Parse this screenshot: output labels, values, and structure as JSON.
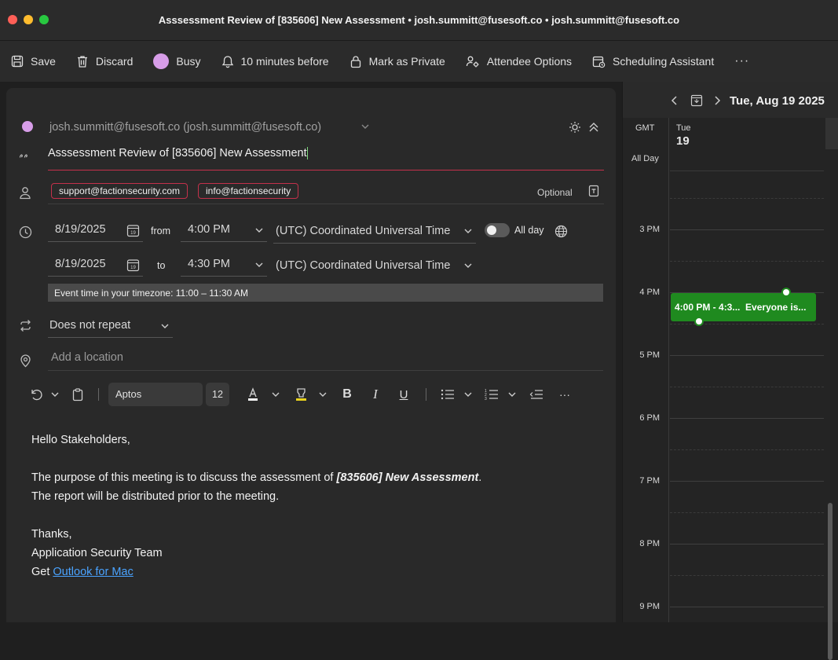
{
  "window": {
    "title": "Asssessment Review of [835606] New Assessment • josh.summitt@fusesoft.co • josh.summitt@fusesoft.co"
  },
  "toolbar": {
    "save": "Save",
    "discard": "Discard",
    "busy": "Busy",
    "reminder": "10 minutes before",
    "private": "Mark as Private",
    "attendee_options": "Attendee Options",
    "scheduling": "Scheduling Assistant",
    "more": "···"
  },
  "colors": {
    "busy": "#d79de8",
    "event": "#1f8a1f",
    "accent_border": "#c4314b",
    "link": "#4aa3ff"
  },
  "compose": {
    "sender": "josh.summitt@fusesoft.co (josh.summitt@fusesoft.co)",
    "subject": "Asssessment Review of [835606] New Assessment",
    "attendees": [
      "support@factionsecurity.com",
      "info@factionsecurity"
    ],
    "optional_label": "Optional",
    "start_date": "8/19/2025",
    "from_label": "from",
    "start_time": "4:00 PM",
    "start_tz": "(UTC) Coordinated Universal Time",
    "allday_label": "All day",
    "allday_on": false,
    "end_date": "8/19/2025",
    "to_label": "to",
    "end_time": "4:30 PM",
    "end_tz": "(UTC) Coordinated Universal Time",
    "local_time_banner": "Event time in your timezone: 11:00 – 11:30 AM",
    "repeat": "Does not repeat",
    "location_placeholder": "Add a location",
    "calendar_icon_day": "19"
  },
  "format_bar": {
    "font": "Aptos",
    "size": "12",
    "more": "···"
  },
  "body": {
    "greeting": "Hello Stakeholders,",
    "line1_prefix": "The purpose of this meeting is to discuss the assessment of ",
    "line1_emph": "[835606] New Assessment",
    "line1_suffix": ".",
    "line2": "The report will be distributed prior to the meeting.",
    "thanks": "Thanks,",
    "signature": "Application Security Team",
    "get_prefix": "Get ",
    "get_link": "Outlook for Mac"
  },
  "calendar": {
    "date_label": "Tue, Aug 19 2025",
    "tz_label": "GMT",
    "all_day": "All Day",
    "day_name": "Tue",
    "day_num": "19",
    "hours": [
      "3 PM",
      "4 PM",
      "5 PM",
      "6 PM",
      "7 PM",
      "8 PM",
      "9 PM"
    ],
    "event_time": "4:00 PM - 4:3...",
    "event_title": "Everyone is..."
  }
}
